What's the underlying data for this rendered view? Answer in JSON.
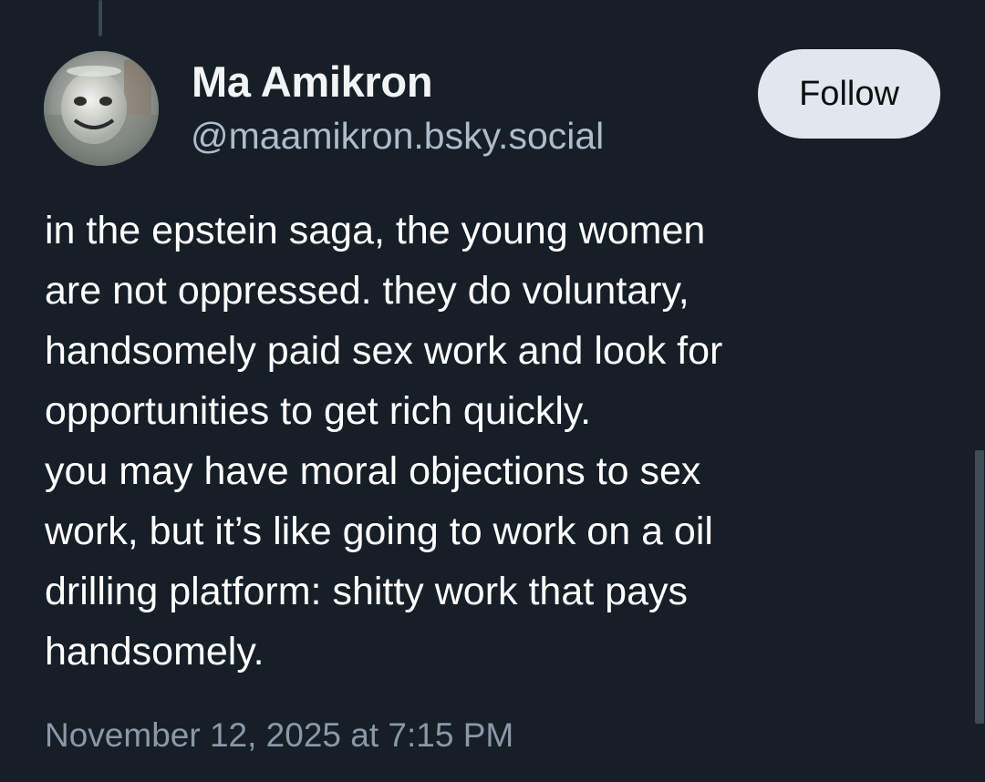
{
  "author": {
    "display_name": "Ma Amikron",
    "handle": "@maamikron.bsky.social",
    "avatar_icon": "avatar-photo"
  },
  "follow_button": {
    "label": "Follow"
  },
  "post": {
    "lines": [
      "in the epstein saga, the young women",
      "are not oppressed. they do voluntary,",
      "handsomely paid sex work and look for",
      "opportunities to get rich quickly.",
      "you may have moral objections to sex",
      "work, but it’s like going to work on a oil",
      "drilling platform: shitty work that pays",
      "handsomely."
    ],
    "timestamp": "November 12, 2025 at 7:15 PM"
  },
  "colors": {
    "background": "#161e27",
    "text": "#ffffff",
    "handle": "#aebbc9",
    "timestamp": "#8b98a7",
    "follow_bg": "#e2e7ee"
  }
}
